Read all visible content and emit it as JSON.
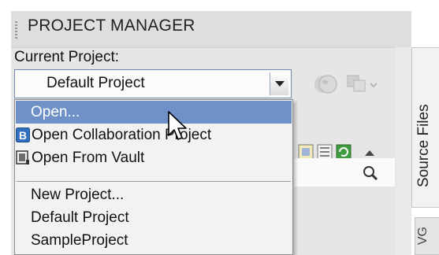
{
  "panel": {
    "title": "PROJECT MANAGER"
  },
  "current_project": {
    "label": "Current Project:",
    "selected": "Default Project"
  },
  "dropdown": {
    "items": [
      {
        "label": "Open...",
        "icon": null,
        "highlighted": true
      },
      {
        "label": "Open Collaboration Project",
        "icon": "collaboration-b-icon"
      },
      {
        "label": "Open From Vault",
        "icon": "vault-icon"
      },
      {
        "label": "New Project...",
        "icon": null
      },
      {
        "label": "Default Project",
        "icon": null
      },
      {
        "label": "SampleProject",
        "icon": null
      }
    ]
  },
  "side_tabs": {
    "source_files": "Source Files",
    "partial": "VG"
  },
  "colors": {
    "highlight": "#6f91c8",
    "combo_border": "#6f89b0",
    "panel_bg": "#e6e6e6"
  }
}
